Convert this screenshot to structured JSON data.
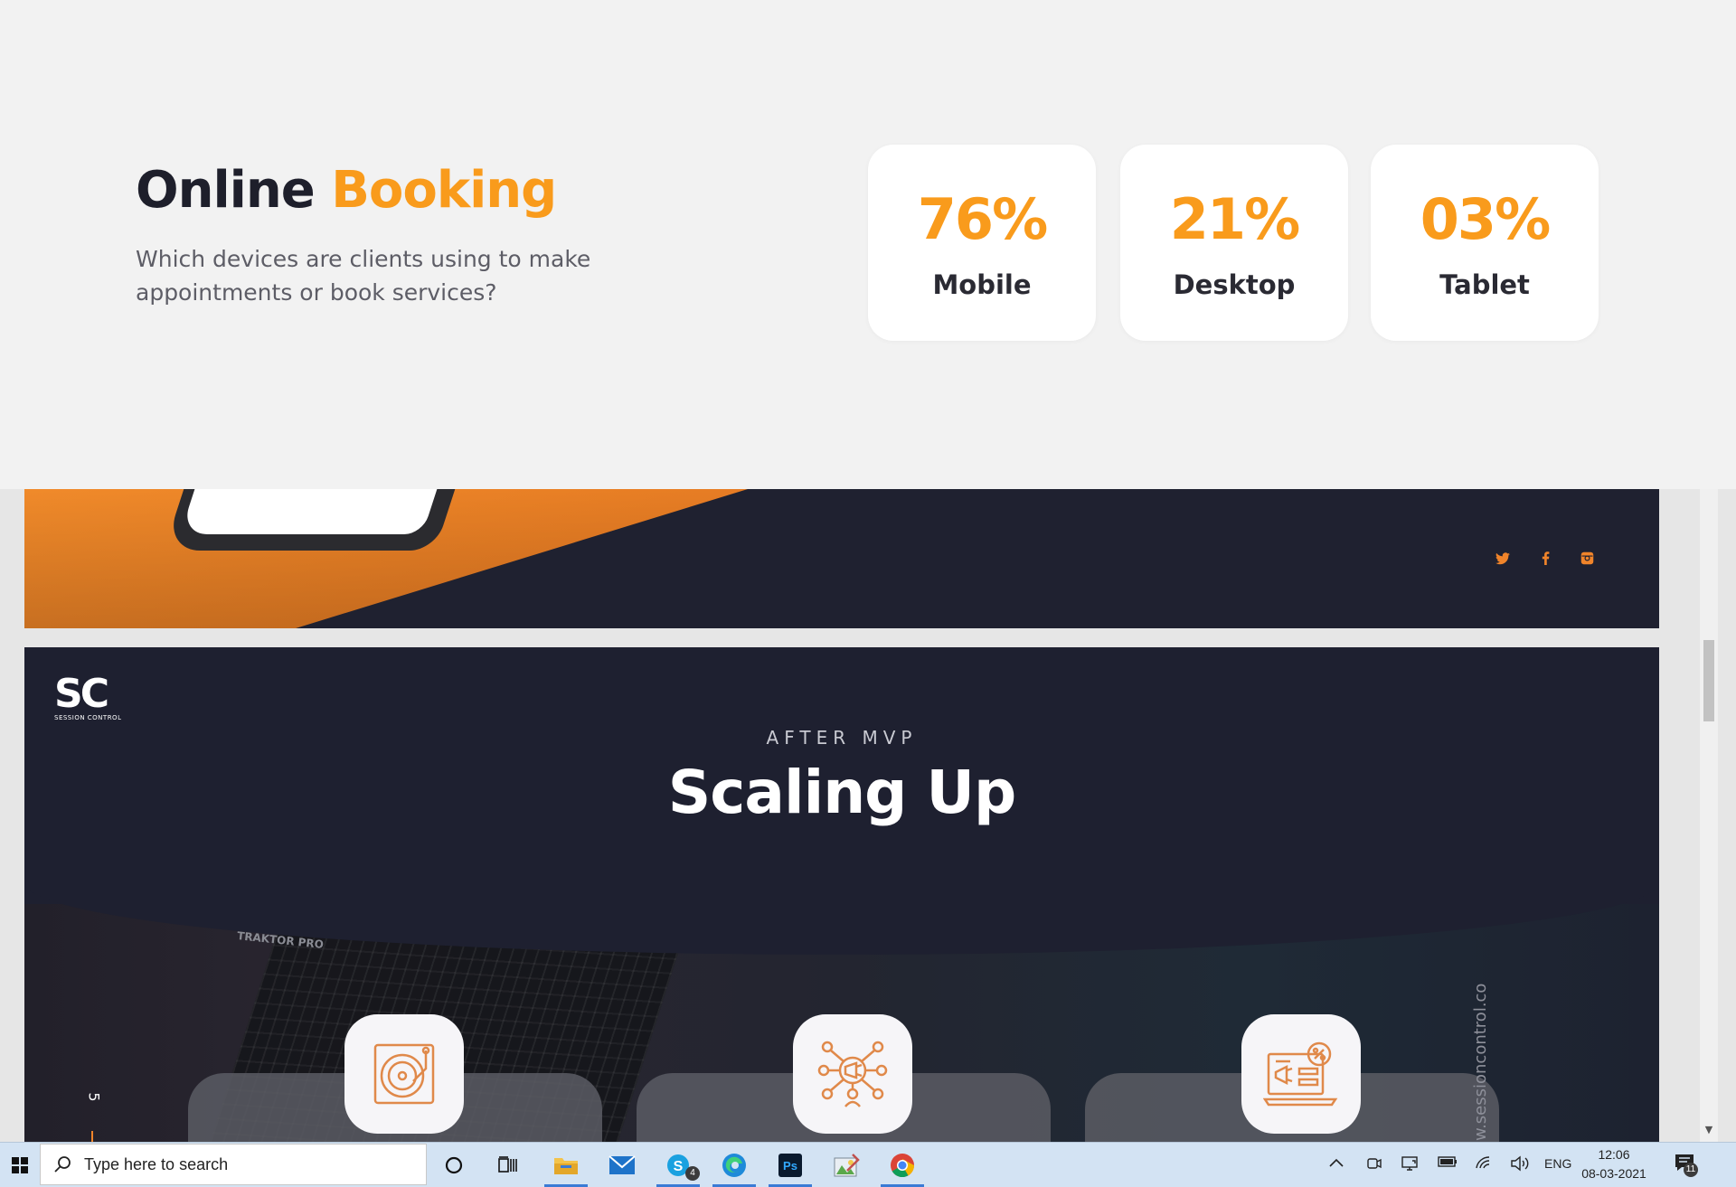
{
  "online_booking": {
    "title_main": "Online",
    "title_accent": "Booking",
    "description": "Which devices are clients using to make appointments or book services?",
    "stats": [
      {
        "value": "76%",
        "label": "Mobile"
      },
      {
        "value": "21%",
        "label": "Desktop"
      },
      {
        "value": "03%",
        "label": "Tablet"
      }
    ],
    "accent_color": "#f99b1c"
  },
  "social": {
    "icons": [
      "twitter-icon",
      "facebook-icon",
      "instagram-icon"
    ]
  },
  "scaling_slide": {
    "logo_mark": "SC",
    "logo_sub": "SESSION CONTROL",
    "eyebrow": "AFTER MVP",
    "title": "Scaling Up",
    "photo_label": "TRAKTOR PRO",
    "page_number": "5",
    "vertical_url": "w.sessioncontrol.co",
    "feature_icons": [
      "turntable-icon",
      "marketing-network-icon",
      "promotion-laptop-icon"
    ]
  },
  "taskbar": {
    "search_placeholder": "Type here to search",
    "skype_badge": "4",
    "language": "ENG",
    "time": "12:06",
    "date": "08-03-2021",
    "notification_count": "11"
  }
}
